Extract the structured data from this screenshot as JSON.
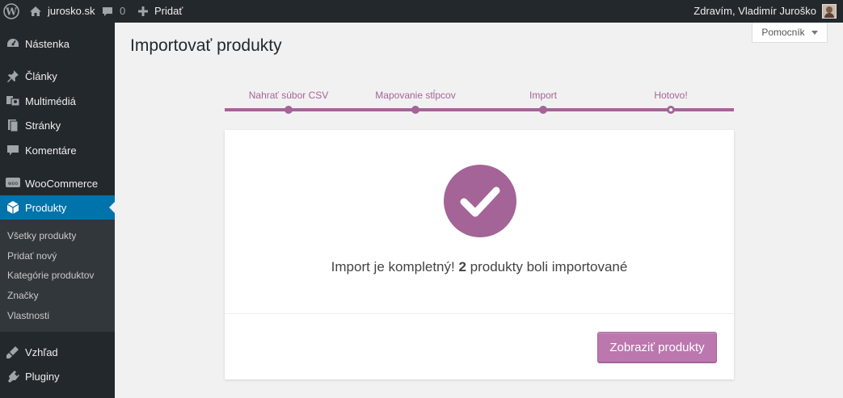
{
  "adminbar": {
    "site_name": "jurosko.sk",
    "comments_count": "0",
    "new_label": "Pridať",
    "greeting": "Zdravím, Vladimír Juroško"
  },
  "sidebar": {
    "items": [
      {
        "label": "Nástenka",
        "icon": "dashboard-icon"
      },
      {
        "label": "Články",
        "icon": "pushpin-icon"
      },
      {
        "label": "Multimédiá",
        "icon": "media-icon"
      },
      {
        "label": "Stránky",
        "icon": "pages-icon"
      },
      {
        "label": "Komentáre",
        "icon": "comments-icon"
      },
      {
        "label": "WooCommerce",
        "icon": "woocommerce-icon"
      },
      {
        "label": "Produkty",
        "icon": "products-icon"
      },
      {
        "label": "Vzhľad",
        "icon": "appearance-icon"
      },
      {
        "label": "Pluginy",
        "icon": "plugins-icon"
      }
    ],
    "submenu": [
      "Všetky produkty",
      "Pridať nový",
      "Kategórie produktov",
      "Značky",
      "Vlastnosti"
    ]
  },
  "help_tab": "Pomocník",
  "page_title": "Importovať produkty",
  "steps": [
    "Nahrať súbor CSV",
    "Mapovanie stĺpcov",
    "Import",
    "Hotovo!"
  ],
  "result": {
    "prefix": "Import je kompletný!",
    "count": "2",
    "suffix": "produkty boli importované"
  },
  "view_button": "Zobraziť produkty",
  "colors": {
    "accent": "#a46497",
    "button": "#bb77ae",
    "admin_dark": "#23282d",
    "active_menu": "#0073aa"
  }
}
